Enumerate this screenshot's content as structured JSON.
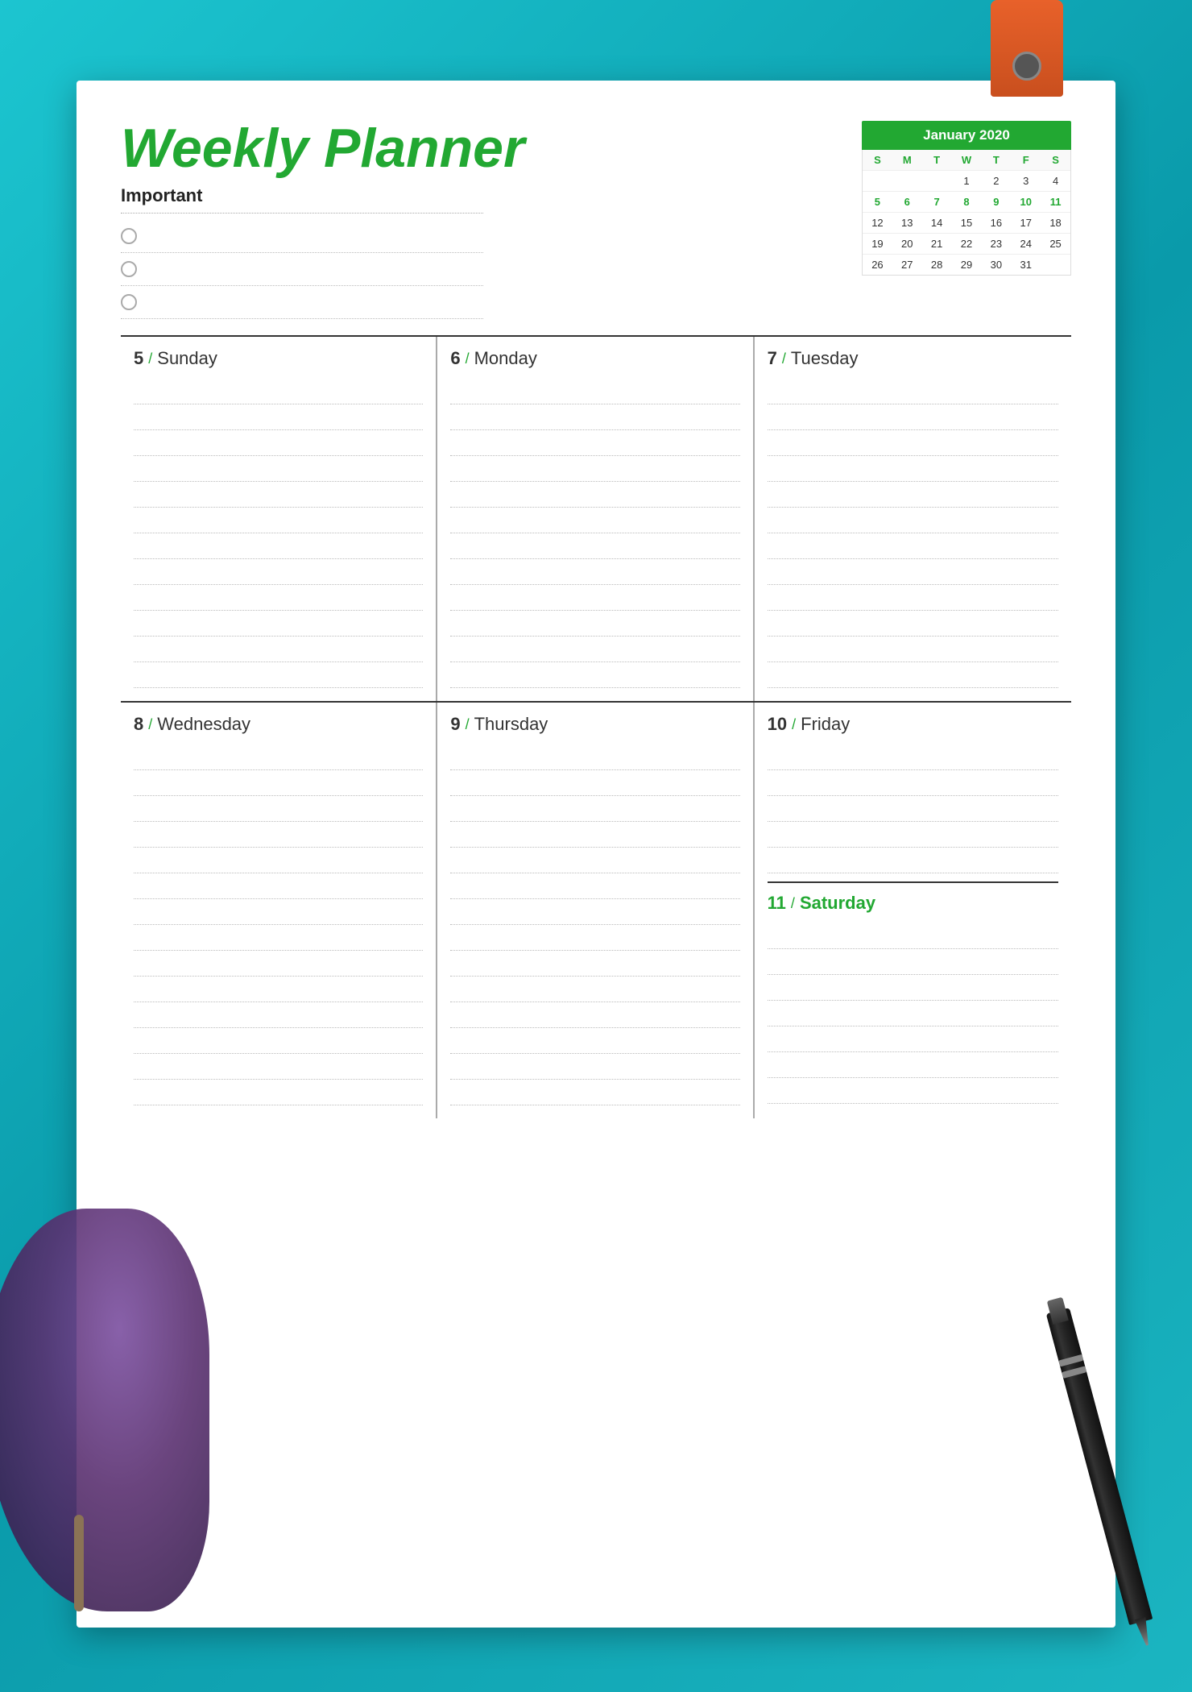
{
  "background": {
    "color": "#1bb5c1"
  },
  "paper": {
    "title": "Weekly Planner",
    "important_label": "Important",
    "todo_items": [
      "",
      "",
      ""
    ]
  },
  "calendar": {
    "month_year": "January 2020",
    "day_names": [
      "S",
      "M",
      "T",
      "W",
      "T",
      "F",
      "S"
    ],
    "weeks": [
      [
        "",
        "",
        "",
        "1",
        "2",
        "3",
        "4"
      ],
      [
        "5",
        "6",
        "7",
        "8",
        "9",
        "10",
        "11"
      ],
      [
        "12",
        "13",
        "14",
        "15",
        "16",
        "17",
        "18"
      ],
      [
        "19",
        "20",
        "21",
        "22",
        "23",
        "24",
        "25"
      ],
      [
        "26",
        "27",
        "28",
        "29",
        "30",
        "31",
        ""
      ]
    ],
    "highlighted_days": [
      "5",
      "6",
      "7",
      "8",
      "9",
      "10",
      "11"
    ]
  },
  "days_row1": [
    {
      "number": "5",
      "name": "Sunday",
      "green": false
    },
    {
      "number": "6",
      "name": "Monday",
      "green": false
    },
    {
      "number": "7",
      "name": "Tuesday",
      "green": false
    }
  ],
  "days_row2": [
    {
      "number": "8",
      "name": "Wednesday",
      "green": false
    },
    {
      "number": "9",
      "name": "Thursday",
      "green": false
    },
    {
      "number": "10",
      "name": "Friday",
      "green": false,
      "split": true
    },
    {
      "number": "11",
      "name": "Saturday",
      "green": true
    }
  ],
  "slash": "/",
  "lines_per_day": 12
}
